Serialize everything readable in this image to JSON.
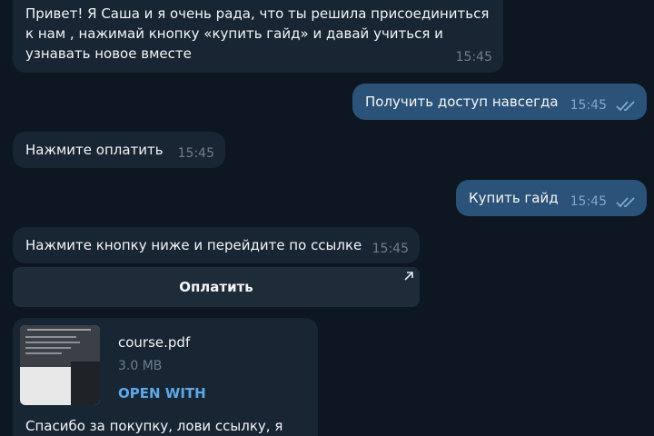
{
  "messages": {
    "m1": {
      "text": "Привет! Я Саша и я очень рада, что ты решила присоединиться к нам , нажимай кнопку «купить гайд» и давай учиться и узнавать новое вместе",
      "time": "15:45"
    },
    "m2": {
      "text": "Получить доступ навсегда",
      "time": "15:45"
    },
    "m3": {
      "text": "Нажмите оплатить",
      "time": "15:45"
    },
    "m4": {
      "text": "Купить гайд",
      "time": "15:45"
    },
    "m5": {
      "text": "Нажмите кнопку ниже и перейдите по ссылке",
      "time": "15:45",
      "button_label": "Оплатить"
    },
    "m6": {
      "file_name": "course.pdf",
      "file_size": "3.0 MB",
      "open_with": "OPEN WITH",
      "caption": "Спасибо за покупку, лови  ссылку, я"
    }
  },
  "icons": {
    "read_checks": "double-check-icon",
    "external_link": "arrow-up-right-icon",
    "file_thumbnail": "pdf-thumbnail"
  },
  "colors": {
    "background": "#0e1621",
    "incoming_bubble": "#182533",
    "outgoing_bubble": "#2b5278",
    "accent_link": "#5fa8e8"
  }
}
